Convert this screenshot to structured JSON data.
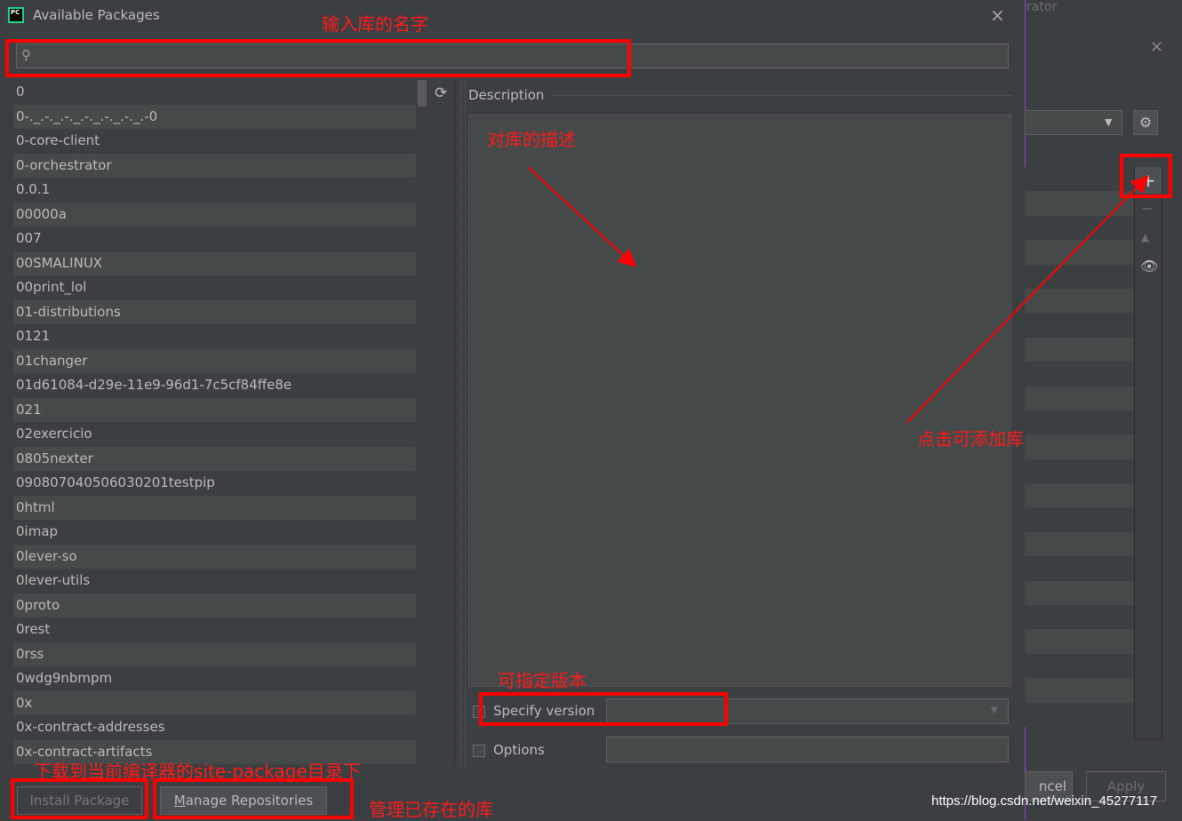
{
  "background_dialog": {
    "title_fragment": "rator",
    "close_glyph": "×",
    "add_glyph": "+",
    "minus_glyph": "−",
    "up_glyph": "▲",
    "eye_glyph": "👁",
    "gear_glyph": "⚙",
    "combo_arrow": "▼",
    "cancel_label": "ncel",
    "apply_label": "Apply"
  },
  "dialog": {
    "title": "Available Packages",
    "app_icon_text": "PC",
    "close_glyph": "×"
  },
  "search": {
    "icon": "search-icon",
    "icon_glyph": "⚲",
    "value": "",
    "placeholder": ""
  },
  "packages": [
    "0",
    "0-._.-._.-._.-._.-._.-._.-0",
    "0-core-client",
    "0-orchestrator",
    "0.0.1",
    "00000a",
    "007",
    "00SMALINUX",
    "00print_lol",
    "01-distributions",
    "0121",
    "01changer",
    "01d61084-d29e-11e9-96d1-7c5cf84ffe8e",
    "021",
    "02exercicio",
    "0805nexter",
    "090807040506030201testpip",
    "0html",
    "0imap",
    "0lever-so",
    "0lever-utils",
    "0proto",
    "0rest",
    "0rss",
    "0wdg9nbmpm",
    "0x",
    "0x-contract-addresses",
    "0x-contract-artifacts"
  ],
  "refresh_glyph": "⟳",
  "description": {
    "label": "Description",
    "text": ""
  },
  "specify_version": {
    "label": "Specify version",
    "value": "",
    "arrow": "▼"
  },
  "options": {
    "label": "Options",
    "value": ""
  },
  "buttons": {
    "install": "Install Package",
    "manage": "Manage Repositories"
  },
  "annotations": {
    "search_hint": "输入库的名字",
    "desc_hint": "对库的描述",
    "add_hint": "点击可添加库",
    "version_hint": "可指定版本",
    "install_hint": "下载到当前编译器的site-package目录下",
    "manage_hint": "管理已存在的库"
  },
  "watermark": "https://blog.csdn.net/weixin_45277117",
  "colors": {
    "annotation": "#ff0000",
    "background": "#3c3f41",
    "row_alt": "#45494a",
    "text": "#bbbbbb"
  }
}
